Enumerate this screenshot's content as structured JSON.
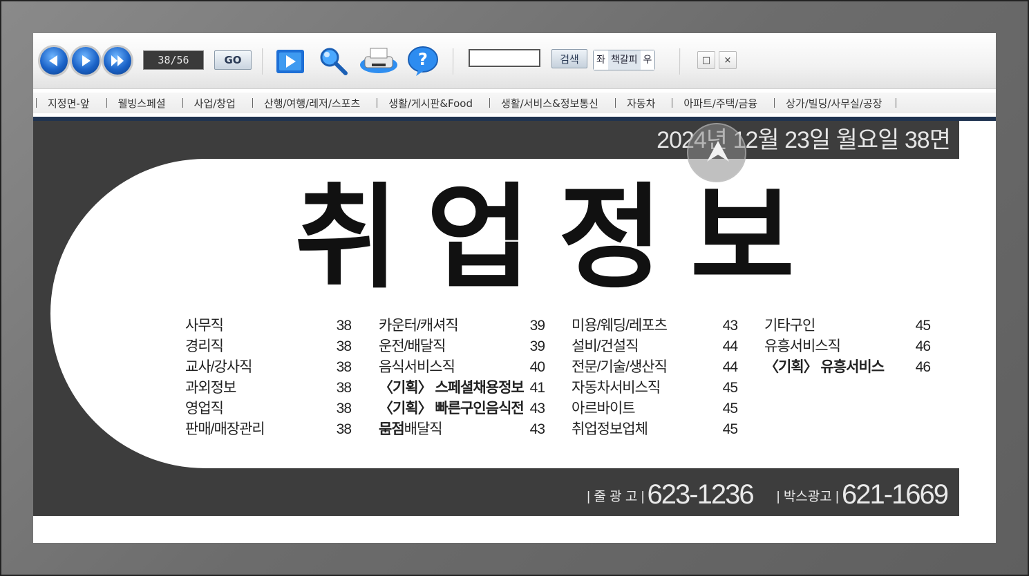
{
  "toolbar": {
    "page_indicator": "38/56",
    "go_label": "GO",
    "search_label": "검색",
    "toggle": [
      "좌",
      "책갈피",
      "우"
    ],
    "window_buttons": [
      "□",
      "×"
    ],
    "icons": [
      "prev-page-icon",
      "next-page-icon",
      "last-page-icon",
      "page-flip-icon",
      "zoom-icon",
      "print-icon",
      "help-icon"
    ]
  },
  "menu": {
    "items": [
      "지정면-앞",
      "웰빙스페셜",
      "사업/창업",
      "산행/여행/레저/스포츠",
      "생활/게시판&Food",
      "생활/서비스&정보통신",
      "자동차",
      "아파트/주택/금융",
      "상가/빌딩/사무실/공장"
    ]
  },
  "page": {
    "date_line": "2024년 12월 23일 월요일  38면",
    "title": "취업정보",
    "columns": [
      [
        {
          "label": "사무직",
          "page": "38"
        },
        {
          "label": "경리직",
          "page": "38"
        },
        {
          "label": "교사/강사직",
          "page": "38"
        },
        {
          "label": "과외정보",
          "page": "38"
        },
        {
          "label": "영업직",
          "page": "38"
        },
        {
          "label": "판매/매장관리",
          "page": "38"
        }
      ],
      [
        {
          "label": "카운터/캐셔직",
          "page": "39"
        },
        {
          "label": "운전/배달직",
          "page": "39"
        },
        {
          "label": "음식서비스직",
          "page": "40"
        },
        {
          "label": "〈기획〉 스페셜채용정보",
          "page": "41",
          "bold": true
        },
        {
          "label": "〈기획〉 빠른구인음식전문점",
          "page": "43",
          "bold": true
        },
        {
          "label": "음식배달직",
          "page": "43"
        }
      ],
      [
        {
          "label": "미용/웨딩/레포츠",
          "page": "43"
        },
        {
          "label": "설비/건설직",
          "page": "44"
        },
        {
          "label": "전문/기술/생산직",
          "page": "44"
        },
        {
          "label": "자동차서비스직",
          "page": "45"
        },
        {
          "label": "아르바이트",
          "page": "45"
        },
        {
          "label": "취업정보업체",
          "page": "45"
        }
      ],
      [
        {
          "label": "기타구인",
          "page": "45"
        },
        {
          "label": "유흥서비스직",
          "page": "46"
        },
        {
          "label": "〈기획〉 유흥서비스",
          "page": "46",
          "bold": true
        }
      ]
    ],
    "contact": {
      "line_ad_label": "줄 광 고",
      "line_ad_phone": "623-1236",
      "box_ad_label": "박스광고",
      "box_ad_phone": "621-1669"
    }
  },
  "colors": {
    "dark_band": "#3d3d3d",
    "nav_strip": "#1f3350",
    "button_blue": "#1b63c8"
  }
}
